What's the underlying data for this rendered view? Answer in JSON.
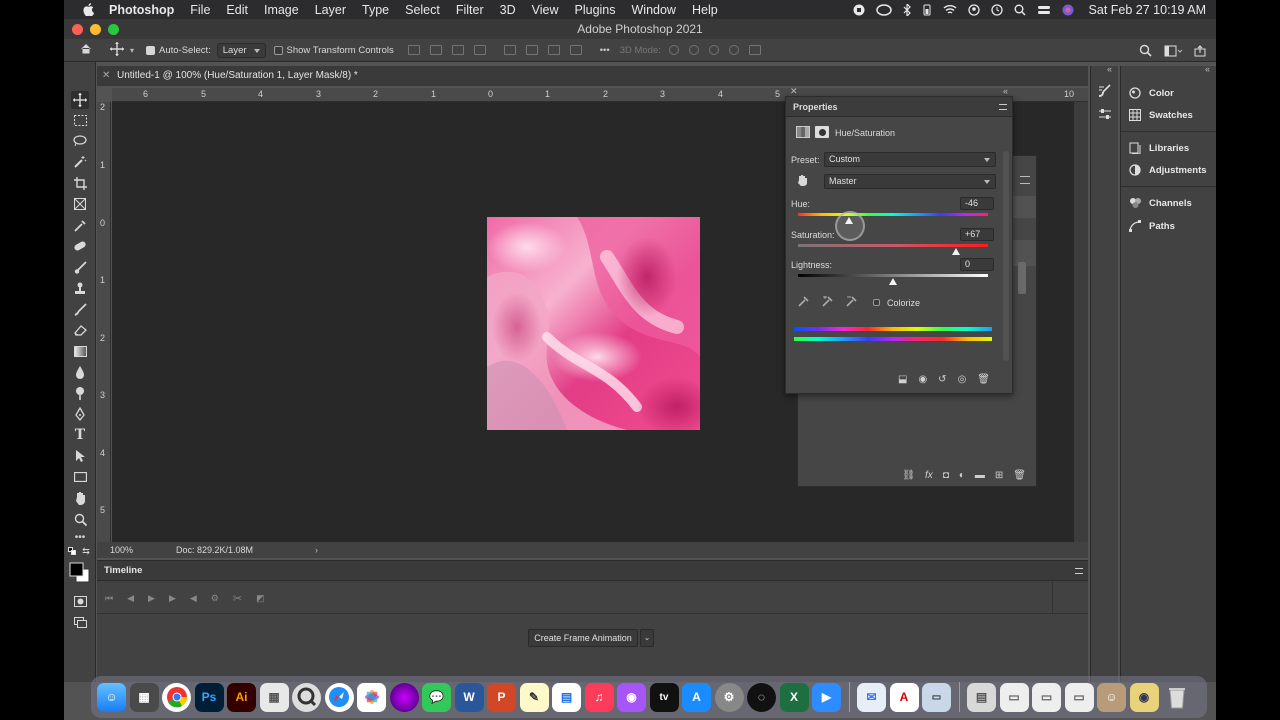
{
  "menubar": {
    "app_name": "Photoshop",
    "items": [
      "File",
      "Edit",
      "Image",
      "Layer",
      "Type",
      "Select",
      "Filter",
      "3D",
      "View",
      "Plugins",
      "Window",
      "Help"
    ],
    "clock": "Sat Feb 27  10:19 AM"
  },
  "window": {
    "title": "Adobe Photoshop 2021"
  },
  "options_bar": {
    "auto_select_label": "Auto-Select:",
    "auto_select_value": "Layer",
    "show_transform_label": "Show Transform Controls",
    "mode_3d_label": "3D Mode:"
  },
  "document": {
    "tab_title": "Untitled-1 @ 100% (Hue/Saturation 1, Layer Mask/8) *",
    "ruler_h": [
      "6",
      "5",
      "4",
      "3",
      "2",
      "1",
      "0",
      "1",
      "2",
      "3",
      "4",
      "5",
      "10"
    ],
    "ruler_v": [
      "2",
      "1",
      "0",
      "1",
      "2",
      "3",
      "4",
      "5"
    ],
    "zoom": "100%",
    "doc_size": "Doc: 829.2K/1.08M"
  },
  "properties": {
    "title": "Properties",
    "adjustment_name": "Hue/Saturation",
    "preset_label": "Preset:",
    "preset_value": "Custom",
    "channel_value": "Master",
    "hue_label": "Hue:",
    "hue_value": "-46",
    "hue_slider_fraction": 0.27,
    "saturation_label": "Saturation:",
    "saturation_value": "+67",
    "saturation_slider_fraction": 0.83,
    "lightness_label": "Lightness:",
    "lightness_value": "0",
    "lightness_slider_fraction": 0.5,
    "colorize_label": "Colorize"
  },
  "right_panels": {
    "group1": [
      "Color",
      "Swatches"
    ],
    "group2": [
      "Libraries",
      "Adjustments"
    ],
    "group3": [
      "Channels",
      "Paths"
    ]
  },
  "timeline": {
    "title": "Timeline",
    "create_button": "Create Frame Animation"
  },
  "colors": {
    "menubar_bg": "#2c2c2e",
    "panel_bg": "#424242",
    "canvas_bg": "#282828",
    "silk_pink": "#e83d86"
  }
}
